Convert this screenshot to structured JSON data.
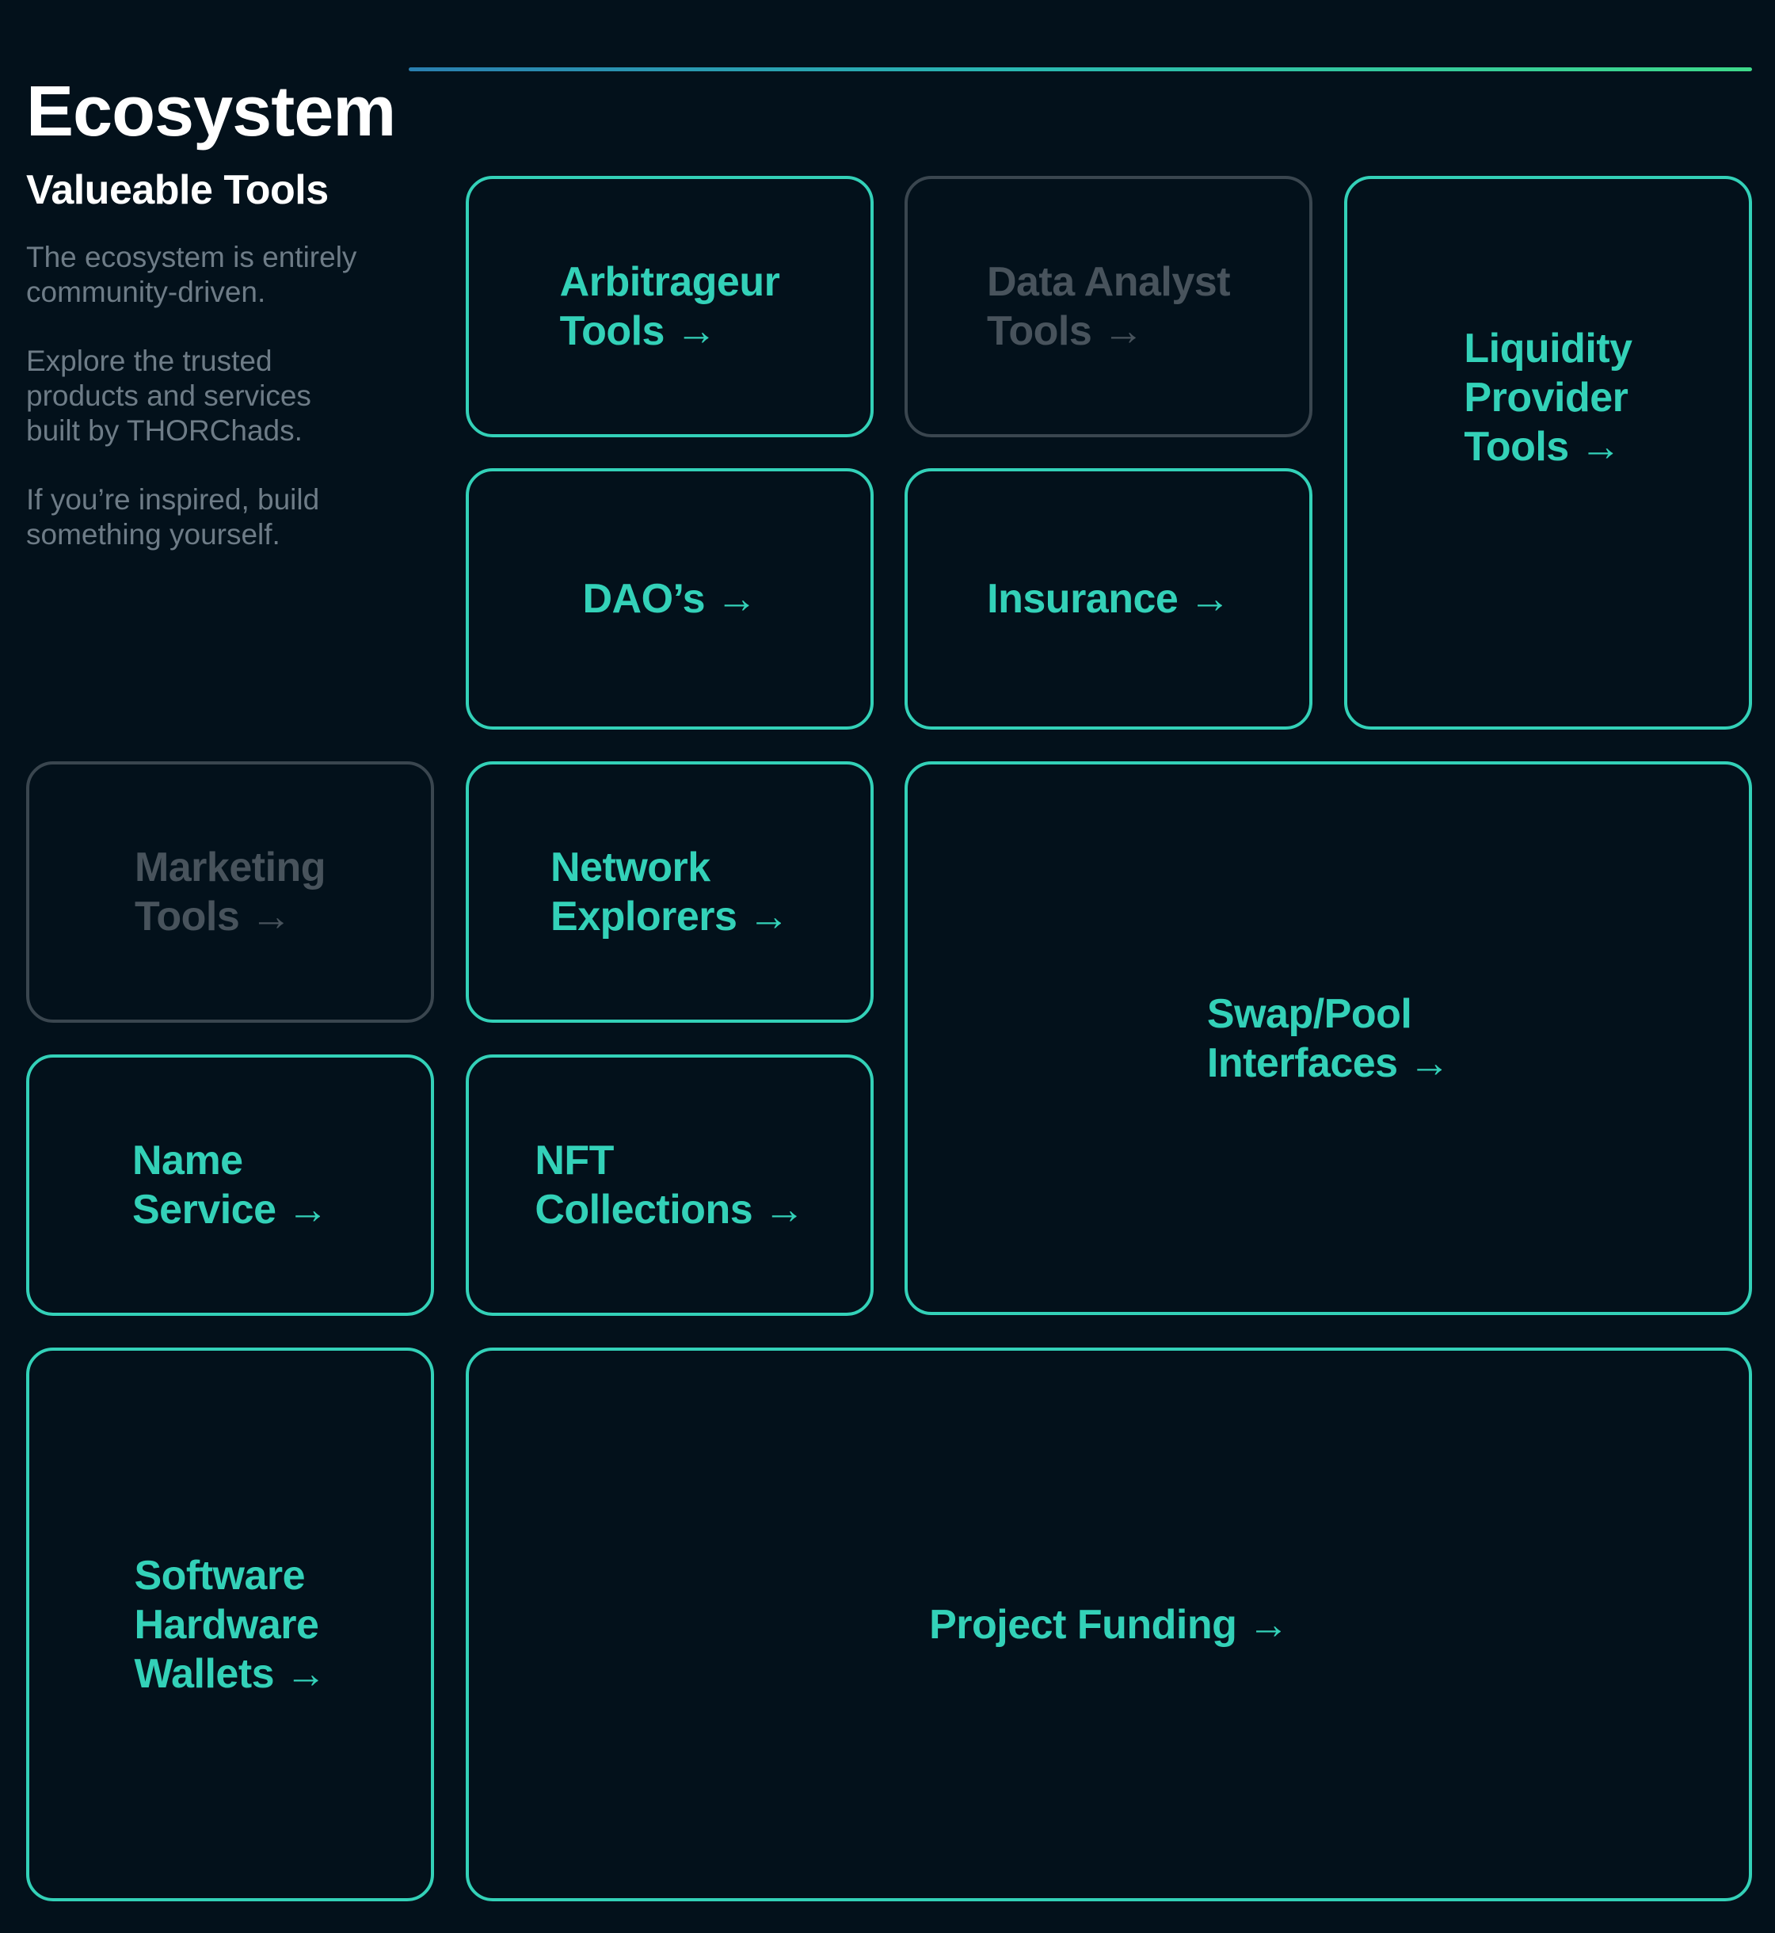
{
  "header": {
    "title": "Ecosystem"
  },
  "intro": {
    "heading": "Valueable Tools",
    "paragraphs": [
      [
        "The ecosystem is entirely",
        "community-driven."
      ],
      [
        "Explore the trusted",
        "products and services",
        "built by THORChads."
      ],
      [
        "If you’re inspired, build",
        "something yourself."
      ]
    ]
  },
  "arrow_glyph": "→",
  "tiles": [
    {
      "lines": [
        "Arbitrageur",
        "Tools"
      ],
      "state": "active"
    },
    {
      "lines": [
        "Data Analyst",
        "Tools"
      ],
      "state": "muted"
    },
    {
      "lines": [
        "Liquidity",
        "Provider",
        "Tools"
      ],
      "state": "active"
    },
    {
      "lines": [
        "DAO’s"
      ],
      "state": "active"
    },
    {
      "lines": [
        "Insurance"
      ],
      "state": "active"
    },
    {
      "lines": [
        "Marketing",
        "Tools"
      ],
      "state": "muted"
    },
    {
      "lines": [
        "Network",
        "Explorers"
      ],
      "state": "active"
    },
    {
      "lines": [
        "Swap/Pool",
        "Interfaces"
      ],
      "state": "active"
    },
    {
      "lines": [
        "Name",
        "Service"
      ],
      "state": "active"
    },
    {
      "lines": [
        "NFT",
        "Collections"
      ],
      "state": "active"
    },
    {
      "lines": [
        "Software",
        "Hardware",
        "Wallets"
      ],
      "state": "active"
    },
    {
      "lines": [
        "Project Funding"
      ],
      "state": "active"
    }
  ],
  "colors": {
    "background": "#03111b",
    "accent": "#33d1b8",
    "muted_border": "#3a464f",
    "muted_text": "#48535c",
    "body_text": "#6e7c87"
  }
}
